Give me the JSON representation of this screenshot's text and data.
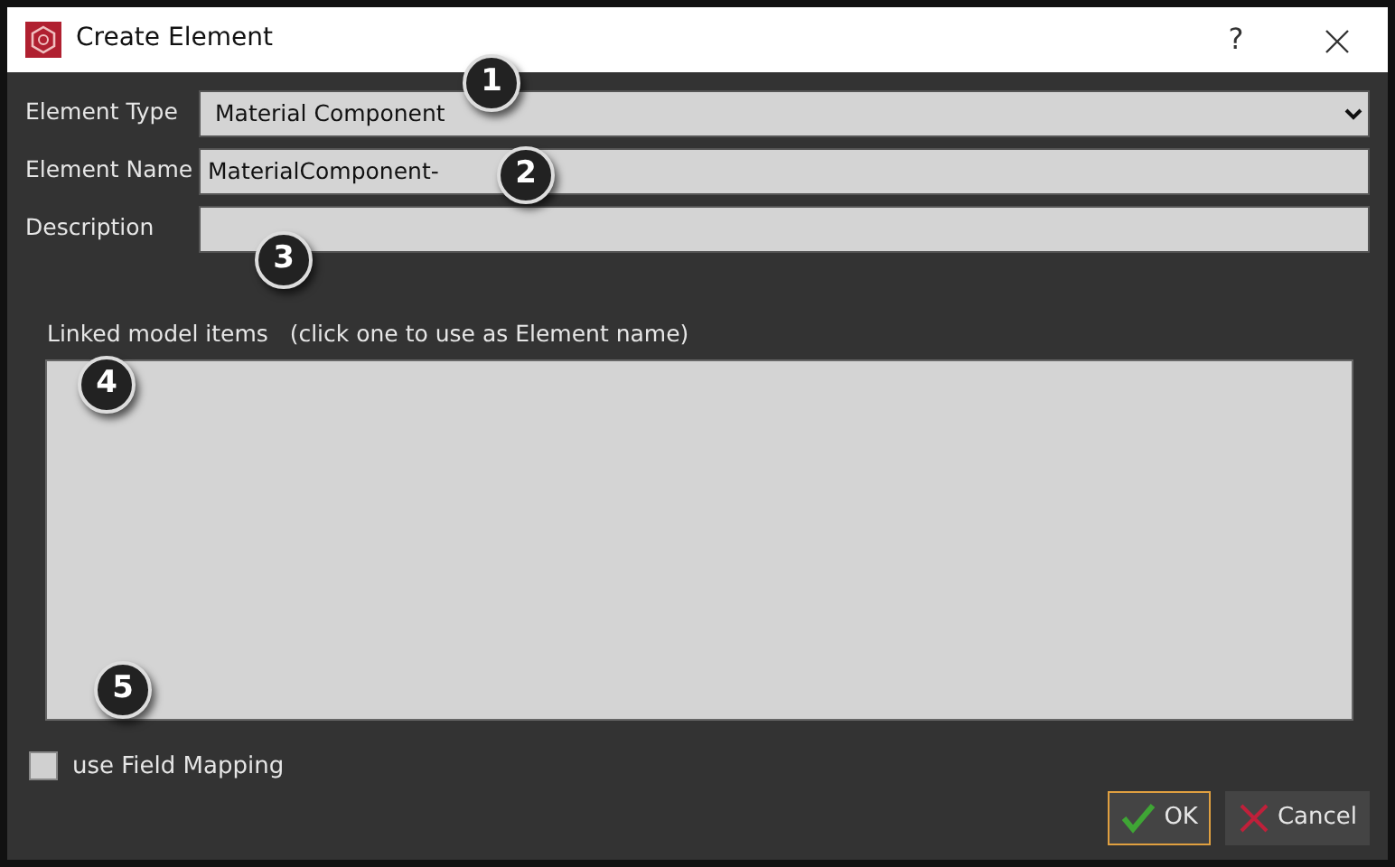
{
  "window": {
    "title": "Create Element",
    "help": "?"
  },
  "fields": [
    {
      "kind": "select",
      "label": "Element Type",
      "value": "Material Component"
    },
    {
      "kind": "text",
      "label": "Element Name",
      "value": "MaterialComponent-"
    },
    {
      "kind": "text",
      "label": "Description"
    }
  ],
  "linked_items": {
    "label": "Linked model items   (click one to use as Element name)"
  },
  "use_field_mapping": {
    "label": "use Field Mapping",
    "checked": false
  },
  "buttons": [
    {
      "kind": "ok",
      "label": "OK",
      "focused": true
    },
    {
      "kind": "cancel",
      "label": "Cancel",
      "focused": false
    }
  ],
  "callouts": [
    "1",
    "2",
    "3",
    "4",
    "5"
  ]
}
